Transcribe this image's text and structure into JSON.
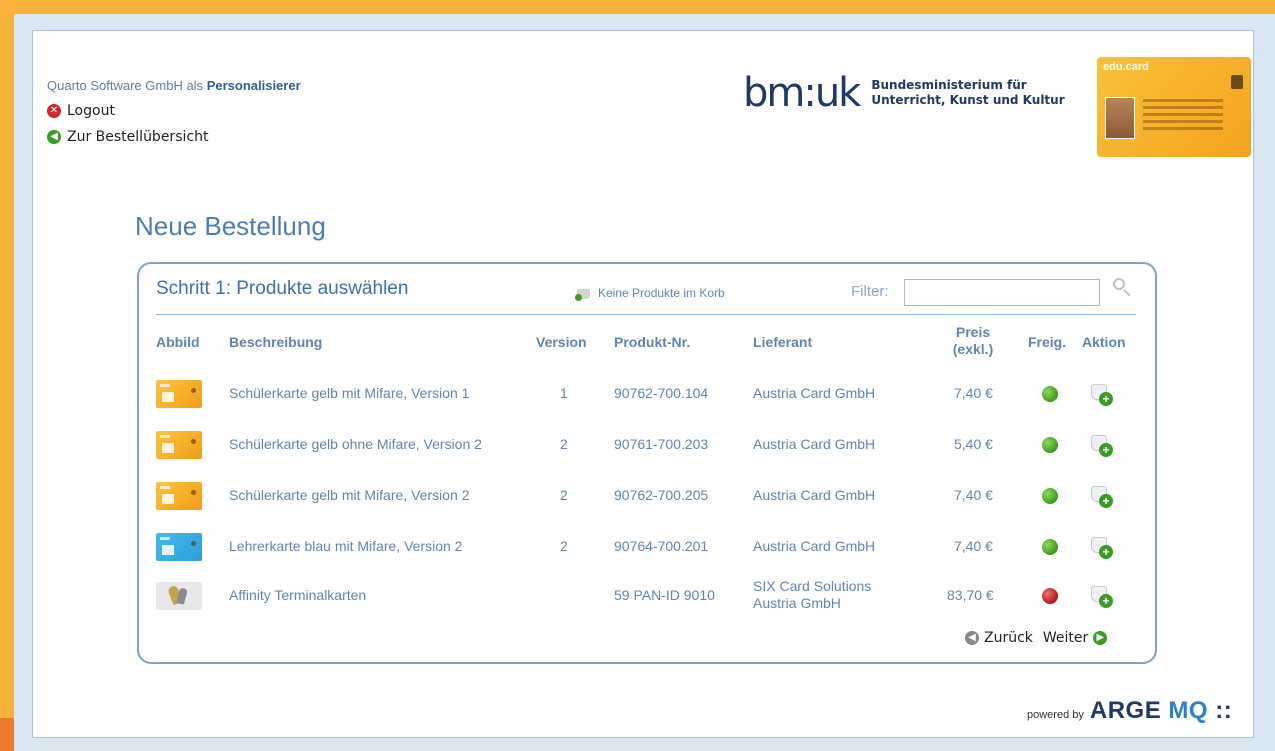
{
  "header": {
    "company_prefix": "Quarto Software GmbH als",
    "company_role": "Personalisierer",
    "logout_label": "Logout",
    "back_overview_label": "Zur Bestellübersicht",
    "ministry_logo": "bm:uk",
    "ministry_name_line1": "Bundesministerium für",
    "ministry_name_line2": "Unterricht, Kunst und Kultur",
    "educard_title": "edu.card"
  },
  "page_title": "Neue Bestellung",
  "panel": {
    "step_title": "Schritt 1: Produkte auswählen",
    "basket_status": "Keine Produkte im Korb",
    "filter_label": "Filter:",
    "filter_value": ""
  },
  "table": {
    "columns": {
      "image": "Abbild",
      "description": "Beschreibung",
      "version": "Version",
      "product_no": "Produkt-Nr.",
      "supplier": "Lieferant",
      "price_line1": "Preis",
      "price_line2": "(exkl.)",
      "released": "Freig.",
      "action": "Aktion"
    },
    "rows": [
      {
        "thumb": "yellow-card",
        "description": "Schülerkarte gelb mit Mifare, Version 1",
        "version": "1",
        "product_no": "90762-700.104",
        "supplier_line1": "Austria Card GmbH",
        "supplier_line2": "",
        "price": "7,40 €",
        "status": "green"
      },
      {
        "thumb": "yellow-card",
        "description": "Schülerkarte gelb ohne Mifare, Version 2",
        "version": "2",
        "product_no": "90761-700.203",
        "supplier_line1": "Austria Card GmbH",
        "supplier_line2": "",
        "price": "5,40 €",
        "status": "green"
      },
      {
        "thumb": "yellow-card",
        "description": "Schülerkarte gelb mit Mifare, Version 2",
        "version": "2",
        "product_no": "90762-700.205",
        "supplier_line1": "Austria Card GmbH",
        "supplier_line2": "",
        "price": "7,40 €",
        "status": "green"
      },
      {
        "thumb": "blue-card",
        "description": "Lehrerkarte blau mit Mifare, Version 2",
        "version": "2",
        "product_no": "90764-700.201",
        "supplier_line1": "Austria Card GmbH",
        "supplier_line2": "",
        "price": "7,40 €",
        "status": "green"
      },
      {
        "thumb": "keys",
        "description": "Affinity Terminalkarten",
        "version": "",
        "product_no": "59 PAN-ID 9010",
        "supplier_line1": "SIX Card Solutions",
        "supplier_line2": "Austria GmbH",
        "price": "83,70 €",
        "status": "red"
      }
    ]
  },
  "pager": {
    "back_label": "Zurück",
    "next_label": "Weiter"
  },
  "footer": {
    "powered_by": "powered by",
    "brand_arge": "ARGE",
    "brand_mq": "MQ",
    "brand_suffix": "::"
  },
  "colors": {
    "accent_orange": "#f7b23c",
    "heading_blue": "#4a7fb3",
    "link_blue": "#5f86b0",
    "status_green": "#3c9a1e",
    "status_red": "#b3141b"
  },
  "icons": {
    "logout": "close-circle-icon",
    "back_overview": "arrow-left-circle-icon",
    "basket": "basket-icon",
    "search": "search-icon",
    "add_to_basket": "add-to-basket-icon",
    "pager_back": "arrow-left-circle-icon",
    "pager_next": "arrow-right-circle-icon"
  }
}
